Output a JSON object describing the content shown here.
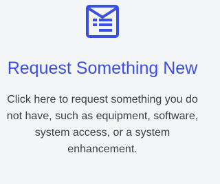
{
  "card": {
    "icon": "envelope-list-icon",
    "title": "Request Something New",
    "description": "Click here to request something you do not have, such as equipment, software, system access, or a system enhancement.",
    "accent_color": "#3b4fe0",
    "text_color": "#3a3f47",
    "background_color": "#f4f5f7"
  }
}
